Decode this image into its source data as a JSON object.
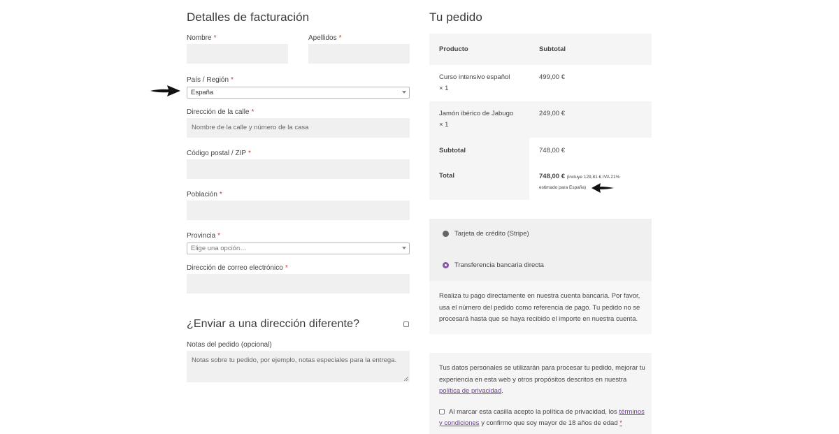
{
  "billing": {
    "title": "Detalles de facturación",
    "first_name_label": "Nombre",
    "last_name_label": "Apellidos",
    "country_label": "País / Región",
    "country_value": "España",
    "street_label": "Dirección de la calle",
    "street_placeholder": "Nombre de la calle y número de la casa",
    "zip_label": "Código postal / ZIP",
    "city_label": "Población",
    "province_label": "Provincia",
    "province_placeholder": "Elige una opción…",
    "email_label": "Dirección de correo electrónico",
    "required_mark": "*"
  },
  "shipping": {
    "different_address_label": "¿Enviar a una dirección diferente?",
    "notes_label": "Notas del pedido (opcional)",
    "notes_placeholder": "Notas sobre tu pedido, por ejemplo, notas especiales para la entrega."
  },
  "order": {
    "title": "Tu pedido",
    "col_product": "Producto",
    "col_subtotal": "Subtotal",
    "items": [
      {
        "name": "Curso intensivo español",
        "qty": "× 1",
        "price": "499,00 €"
      },
      {
        "name": "Jamón ibérico de Jabugo",
        "qty": "× 1",
        "price": "249,00 €"
      }
    ],
    "subtotal_label": "Subtotal",
    "subtotal_value": "748,00 €",
    "total_label": "Total",
    "total_value": "748,00 €",
    "total_note_1": "(incluye 129,81 € IVA 21%",
    "total_note_2": "estimado para España)"
  },
  "payment": {
    "option_card": "Tarjeta de crédito (Stripe)",
    "option_bank": "Transferencia bancaria directa",
    "bank_desc_1": "Realiza tu pago directamente en nuestra cuenta bancaria. Por favor,",
    "bank_desc_2": "usa el número del pedido como referencia de pago. Tu pedido no se",
    "bank_desc_3": "procesará hasta que se haya recibido el importe en nuestra cuenta."
  },
  "privacy": {
    "line1": "Tus datos personales se utilizarán para procesar tu pedido, mejorar tu",
    "line2": "experiencia en esta web y otros propósitos descritos en nuestra",
    "policy_link": "política de privacidad",
    "period": ".",
    "terms_pre": "Al marcar esta casilla acepto la política de privacidad, los",
    "terms_link_1": "términos",
    "terms_link_2": "y condiciones",
    "terms_post": "y confirmo que soy mayor de 18 años de edad",
    "required_mark": "*"
  },
  "colors": {
    "accent": "#8a56ad",
    "link": "#6c3c99",
    "required": "#c0392b",
    "field_bg": "#f0f0f0"
  },
  "icons": [
    "arrow-right-icon",
    "arrow-left-icon",
    "dropdown-caret-icon",
    "resize-grip-icon"
  ]
}
